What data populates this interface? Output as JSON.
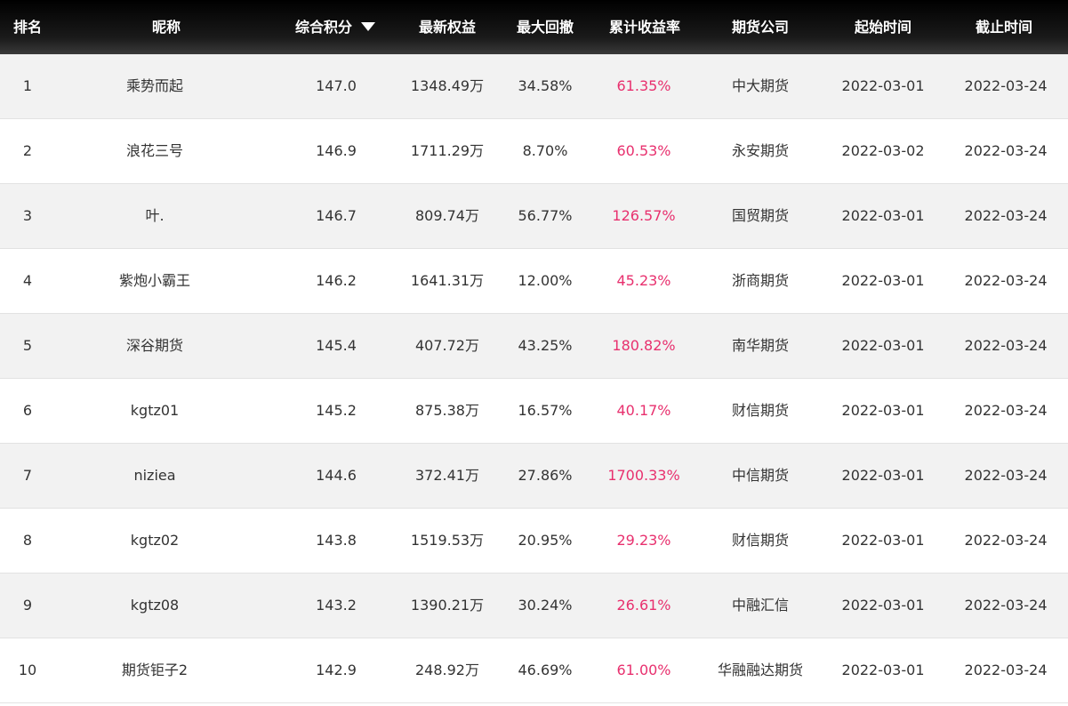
{
  "header": {
    "rank": "排名",
    "nickname": "昵称",
    "score": "综合积分",
    "equity": "最新权益",
    "max_drawdown": "最大回撤",
    "cum_return": "累计收益率",
    "futures_company": "期货公司",
    "start_time": "起始时间",
    "end_time": "截止时间"
  },
  "colors": {
    "header_bg": "#000000",
    "odd_row_bg": "#f2f2f2",
    "even_row_bg": "#ffffff",
    "return_color": "#e8306e",
    "text_color": "#333333"
  },
  "rows": [
    {
      "rank": "1",
      "nickname": "乘势而起",
      "score": "147.0",
      "equity": "1348.49万",
      "max_drawdown": "34.58%",
      "cum_return": "61.35%",
      "futures_company": "中大期货",
      "start_time": "2022-03-01",
      "end_time": "2022-03-24"
    },
    {
      "rank": "2",
      "nickname": "浪花三号",
      "score": "146.9",
      "equity": "1711.29万",
      "max_drawdown": "8.70%",
      "cum_return": "60.53%",
      "futures_company": "永安期货",
      "start_time": "2022-03-02",
      "end_time": "2022-03-24"
    },
    {
      "rank": "3",
      "nickname": "叶.",
      "score": "146.7",
      "equity": "809.74万",
      "max_drawdown": "56.77%",
      "cum_return": "126.57%",
      "futures_company": "国贸期货",
      "start_time": "2022-03-01",
      "end_time": "2022-03-24"
    },
    {
      "rank": "4",
      "nickname": "紫炮小霸王",
      "score": "146.2",
      "equity": "1641.31万",
      "max_drawdown": "12.00%",
      "cum_return": "45.23%",
      "futures_company": "浙商期货",
      "start_time": "2022-03-01",
      "end_time": "2022-03-24"
    },
    {
      "rank": "5",
      "nickname": "深谷期货",
      "score": "145.4",
      "equity": "407.72万",
      "max_drawdown": "43.25%",
      "cum_return": "180.82%",
      "futures_company": "南华期货",
      "start_time": "2022-03-01",
      "end_time": "2022-03-24"
    },
    {
      "rank": "6",
      "nickname": "kgtz01",
      "score": "145.2",
      "equity": "875.38万",
      "max_drawdown": "16.57%",
      "cum_return": "40.17%",
      "futures_company": "财信期货",
      "start_time": "2022-03-01",
      "end_time": "2022-03-24"
    },
    {
      "rank": "7",
      "nickname": "niziea",
      "score": "144.6",
      "equity": "372.41万",
      "max_drawdown": "27.86%",
      "cum_return": "1700.33%",
      "futures_company": "中信期货",
      "start_time": "2022-03-01",
      "end_time": "2022-03-24"
    },
    {
      "rank": "8",
      "nickname": "kgtz02",
      "score": "143.8",
      "equity": "1519.53万",
      "max_drawdown": "20.95%",
      "cum_return": "29.23%",
      "futures_company": "财信期货",
      "start_time": "2022-03-01",
      "end_time": "2022-03-24"
    },
    {
      "rank": "9",
      "nickname": "kgtz08",
      "score": "143.2",
      "equity": "1390.21万",
      "max_drawdown": "30.24%",
      "cum_return": "26.61%",
      "futures_company": "中融汇信",
      "start_time": "2022-03-01",
      "end_time": "2022-03-24"
    },
    {
      "rank": "10",
      "nickname": "期货钜子2",
      "score": "142.9",
      "equity": "248.92万",
      "max_drawdown": "46.69%",
      "cum_return": "61.00%",
      "futures_company": "华融融达期货",
      "start_time": "2022-03-01",
      "end_time": "2022-03-24"
    }
  ]
}
